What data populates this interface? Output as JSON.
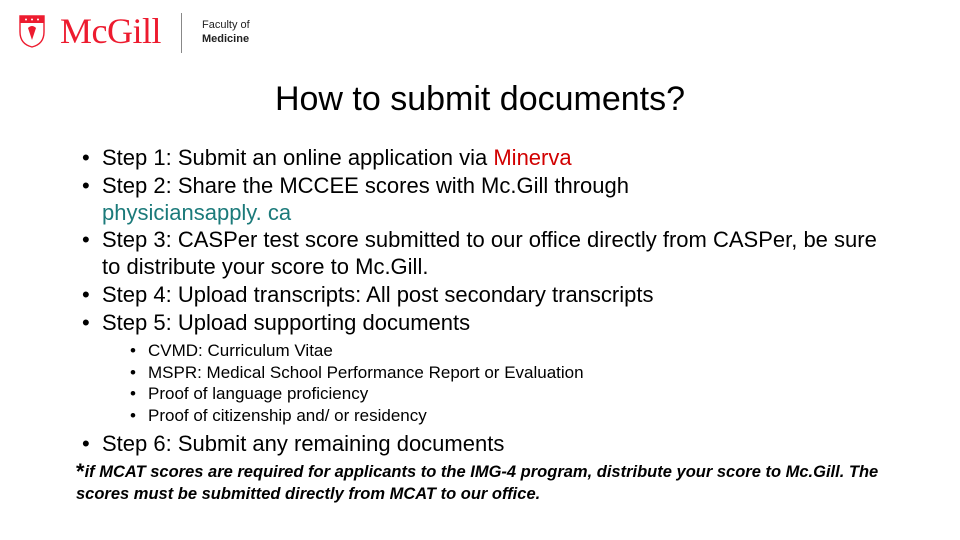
{
  "header": {
    "wordmark": "McGill",
    "faculty_line1": "Faculty of",
    "faculty_line2": "Medicine"
  },
  "title": "How to submit documents?",
  "steps": {
    "s1_prefix": "Step 1: Submit an online application via ",
    "s1_link": "Minerva",
    "s2_prefix": "Step 2: Share the MCCEE scores with Mc.Gill through ",
    "s2_link": "physiciansapply. ca",
    "s3": "Step 3: CASPer test score submitted to our office directly from CASPer, be sure to distribute your score to Mc.Gill.",
    "s4": "Step 4: Upload transcripts: All post secondary transcripts",
    "s5": "Step 5: Upload supporting documents",
    "s6": "Step 6: Submit any remaining documents"
  },
  "sub": {
    "a": "CVMD:  Curriculum Vitae",
    "b": "MSPR:  Medical School Performance Report or Evaluation",
    "c": "Proof of language proficiency",
    "d": "Proof of citizenship and/ or residency"
  },
  "footnote": {
    "star": "*",
    "text": "if MCAT scores are required for applicants to the IMG-4 program, distribute your score to Mc.Gill. The scores must be submitted directly from MCAT to our office."
  }
}
